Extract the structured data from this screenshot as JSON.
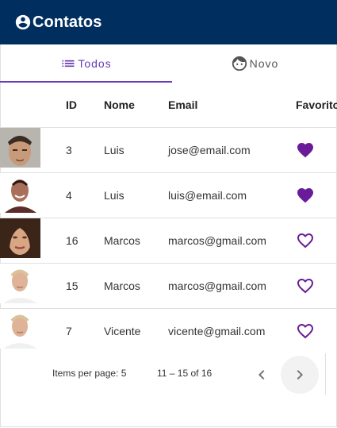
{
  "app": {
    "title": "Contatos"
  },
  "tabs": [
    {
      "label": "Todos",
      "icon": "list-icon",
      "active": true
    },
    {
      "label": "Novo",
      "icon": "face-icon",
      "active": false
    }
  ],
  "table": {
    "headers": {
      "id": "ID",
      "nome": "Nome",
      "email": "Email",
      "favorito": "Favorito"
    },
    "rows": [
      {
        "id": "3",
        "nome": "Luis",
        "email": "jose@email.com",
        "favorito": true,
        "avatar": "man-dark-hair"
      },
      {
        "id": "4",
        "nome": "Luis",
        "email": "luis@email.com",
        "favorito": true,
        "avatar": "man-smiling-bald"
      },
      {
        "id": "16",
        "nome": "Marcos",
        "email": "marcos@gmail.com",
        "favorito": false,
        "avatar": "woman-long-hair"
      },
      {
        "id": "15",
        "nome": "Marcos",
        "email": "marcos@gmail.com",
        "favorito": false,
        "avatar": "man-blond-shirt"
      },
      {
        "id": "7",
        "nome": "Vicente",
        "email": "vicente@gmail.com",
        "favorito": false,
        "avatar": "man-blond-shirt"
      }
    ]
  },
  "paginator": {
    "items_per_page_label": "Items per page: 5",
    "range_label": "11 – 15 of 16"
  },
  "colors": {
    "appbar": "#002f5f",
    "accent": "#673ab7"
  }
}
